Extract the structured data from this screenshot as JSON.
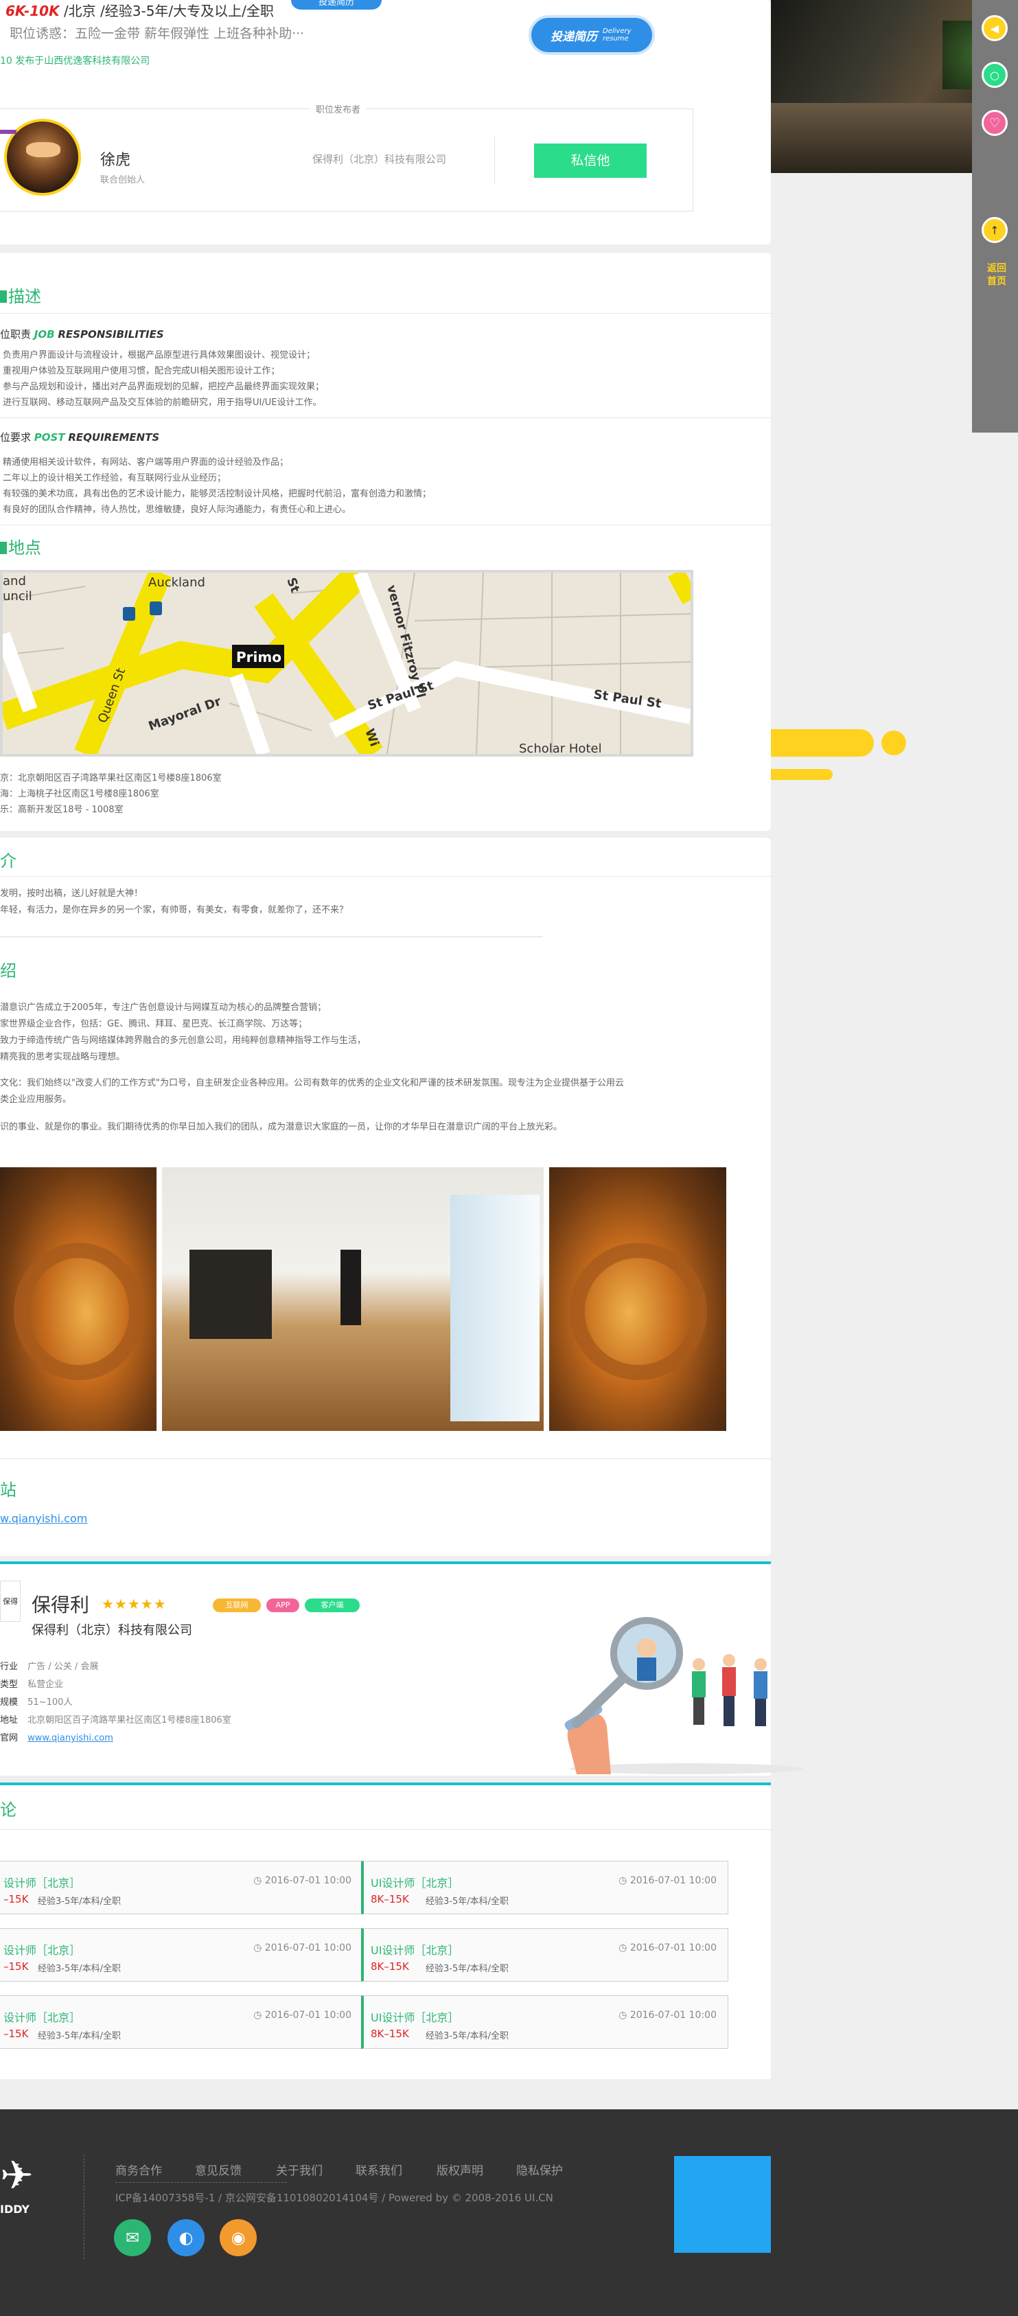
{
  "job": {
    "salary": "6K-10K",
    "details": "/北京 /经验3-5年/大专及以上/全职",
    "perks": "职位诱惑：五险一金带 薪年假弹性 上班各种补助···",
    "publish": "10  发布于山西优逸客科技有限公司",
    "apply_label": "投递简历",
    "apply_sub": "Delivery resume",
    "apply_top_label": "投递简历"
  },
  "publisher": {
    "caption": "职位发布者",
    "name": "徐虎",
    "role": "联合创始人",
    "company": "保得利（北京）科技有限公司",
    "message_label": "私信他"
  },
  "description": {
    "title": "描述",
    "duty_heading_cn": "位职责",
    "duty_heading_en1": "JOB",
    "duty_heading_en2": "RESPONSIBILITIES",
    "duties": [
      "负责用户界面设计与流程设计，根据产品原型进行具体效果图设计、视觉设计；",
      "重视用户体验及互联网用户使用习惯，配合完成UI相关图形设计工作；",
      "参与产品规划和设计，播出对产品界面规划的见解，把控产品最终界面实现效果；",
      "进行互联网、移动互联网产品及交互体验的前瞻研究，用于指导UI/UE设计工作。"
    ],
    "req_heading_cn": "位要求",
    "req_heading_en1": "POST",
    "req_heading_en2": "REQUIREMENTS",
    "requirements": [
      "精通使用相关设计软件，有网站、客户端等用户界面的设计经验及作品；",
      "二年以上的设计相关工作经验，有互联网行业从业经历；",
      "有较强的美术功底，具有出色的艺术设计能力，能够灵活控制设计风格，把握时代前沿，富有创造力和激情；",
      "有良好的团队合作精神，待人热忱，思维敏捷，良好人际沟通能力，有责任心和上进心。"
    ]
  },
  "location": {
    "title": "地点",
    "map_labels": [
      "Auckland",
      "and",
      "uncil",
      "Queen St",
      "Mayoral Dr",
      "Primo",
      "St Paul St",
      "St Paul St",
      "vernor Fitzroy Pl",
      "Scholar Hotel",
      "St",
      "Wi"
    ],
    "addresses": [
      "京：北京朝阳区百子湾路苹果社区南区1号楼8座1806室",
      "海：上海桃子社区南区1号楼8座1806室",
      "乐：高新开发区18号 - 1008室"
    ]
  },
  "team": {
    "title": "介",
    "lines": [
      "发明，按时出稿，送儿好就是大神！",
      "年轻，有活力，是你在异乡的另一个家，有帅哥，有美女，有零食，就差你了，还不来？"
    ]
  },
  "company_intro": {
    "title": "绍",
    "lines": [
      "潜意识广告成立于2005年，专注广告创意设计与网媒互动为核心的品牌整合营销；",
      "家世界级企业合作，包括：GE、腾讯、拜耳、星巴克、长江商学院、万达等；",
      "致力于缔造传统广告与网络媒体跨界融合的多元创意公司，用纯粹创意精神指导工作与生活，",
      "精亮我的思考实现战略与理想。",
      "文化：我们始终以\"改变人们的工作方式\"为口号，自主研发企业各种应用。公司有数年的优秀的企业文化和严谨的技术研发氛围。现专注为企业提供基于公用云",
      "类企业应用服务。",
      "识的事业、就是你的事业。我们期待优秀的你早日加入我们的团队，成为潜意识大家庭的一员，让你的才华早日在潜意识广阔的平台上放光彩。"
    ]
  },
  "website": {
    "title": "站",
    "url": "w.qianyishi.com"
  },
  "company_card": {
    "short_name": "保得利",
    "stars": "★★★★★",
    "tags": [
      "互联网",
      "APP",
      "客户端"
    ],
    "full_name": "保得利（北京）科技有限公司",
    "logo_text": "保得",
    "rows": [
      {
        "label": "行业",
        "value": "广告 / 公关 / 会展"
      },
      {
        "label": "类型",
        "value": "私营企业"
      },
      {
        "label": "规模",
        "value": "51~100人"
      },
      {
        "label": "地址",
        "value": "北京朝阳区百子湾路苹果社区南区1号楼8座1806室"
      },
      {
        "label": "官网",
        "value": "www.qianyishi.com"
      }
    ]
  },
  "discussion": {
    "title": "论",
    "jobs": [
      {
        "title": "设计师［北京］",
        "time": "2016-07-01 10:00",
        "salary": "–15K",
        "meta": "经验3-5年/本科/全职"
      },
      {
        "title": "UI设计师［北京］",
        "time": "2016-07-01 10:00",
        "salary": "8K–15K",
        "meta": "经验3-5年/本科/全职"
      },
      {
        "title": "设计师［北京］",
        "time": "2016-07-01 10:00",
        "salary": "–15K",
        "meta": "经验3-5年/本科/全职"
      },
      {
        "title": "UI设计师［北京］",
        "time": "2016-07-01 10:00",
        "salary": "8K–15K",
        "meta": "经验3-5年/本科/全职"
      },
      {
        "title": "设计师［北京］",
        "time": "2016-07-01 10:00",
        "salary": "–15K",
        "meta": "经验3-5年/本科/全职"
      },
      {
        "title": "UI设计师［北京］",
        "time": "2016-07-01 10:00",
        "salary": "8K–15K",
        "meta": "经验3-5年/本科/全职"
      }
    ]
  },
  "footer": {
    "logo_text": "IDDY",
    "links": [
      "商务合作",
      "意见反馈",
      "关于我们",
      "联系我们",
      "版权声明",
      "隐私保护"
    ],
    "icp": "ICP备14007358号-1  /  京公网安备11010802014104号  /  Powered by © 2008-2016 UI.CN"
  },
  "side": {
    "qr_label": "返回首页"
  },
  "colors": {
    "accent": "#2bb673",
    "salary": "#e02424",
    "apply": "#2f8fe6",
    "footer": "#333333",
    "yellow": "#ffd21f"
  }
}
